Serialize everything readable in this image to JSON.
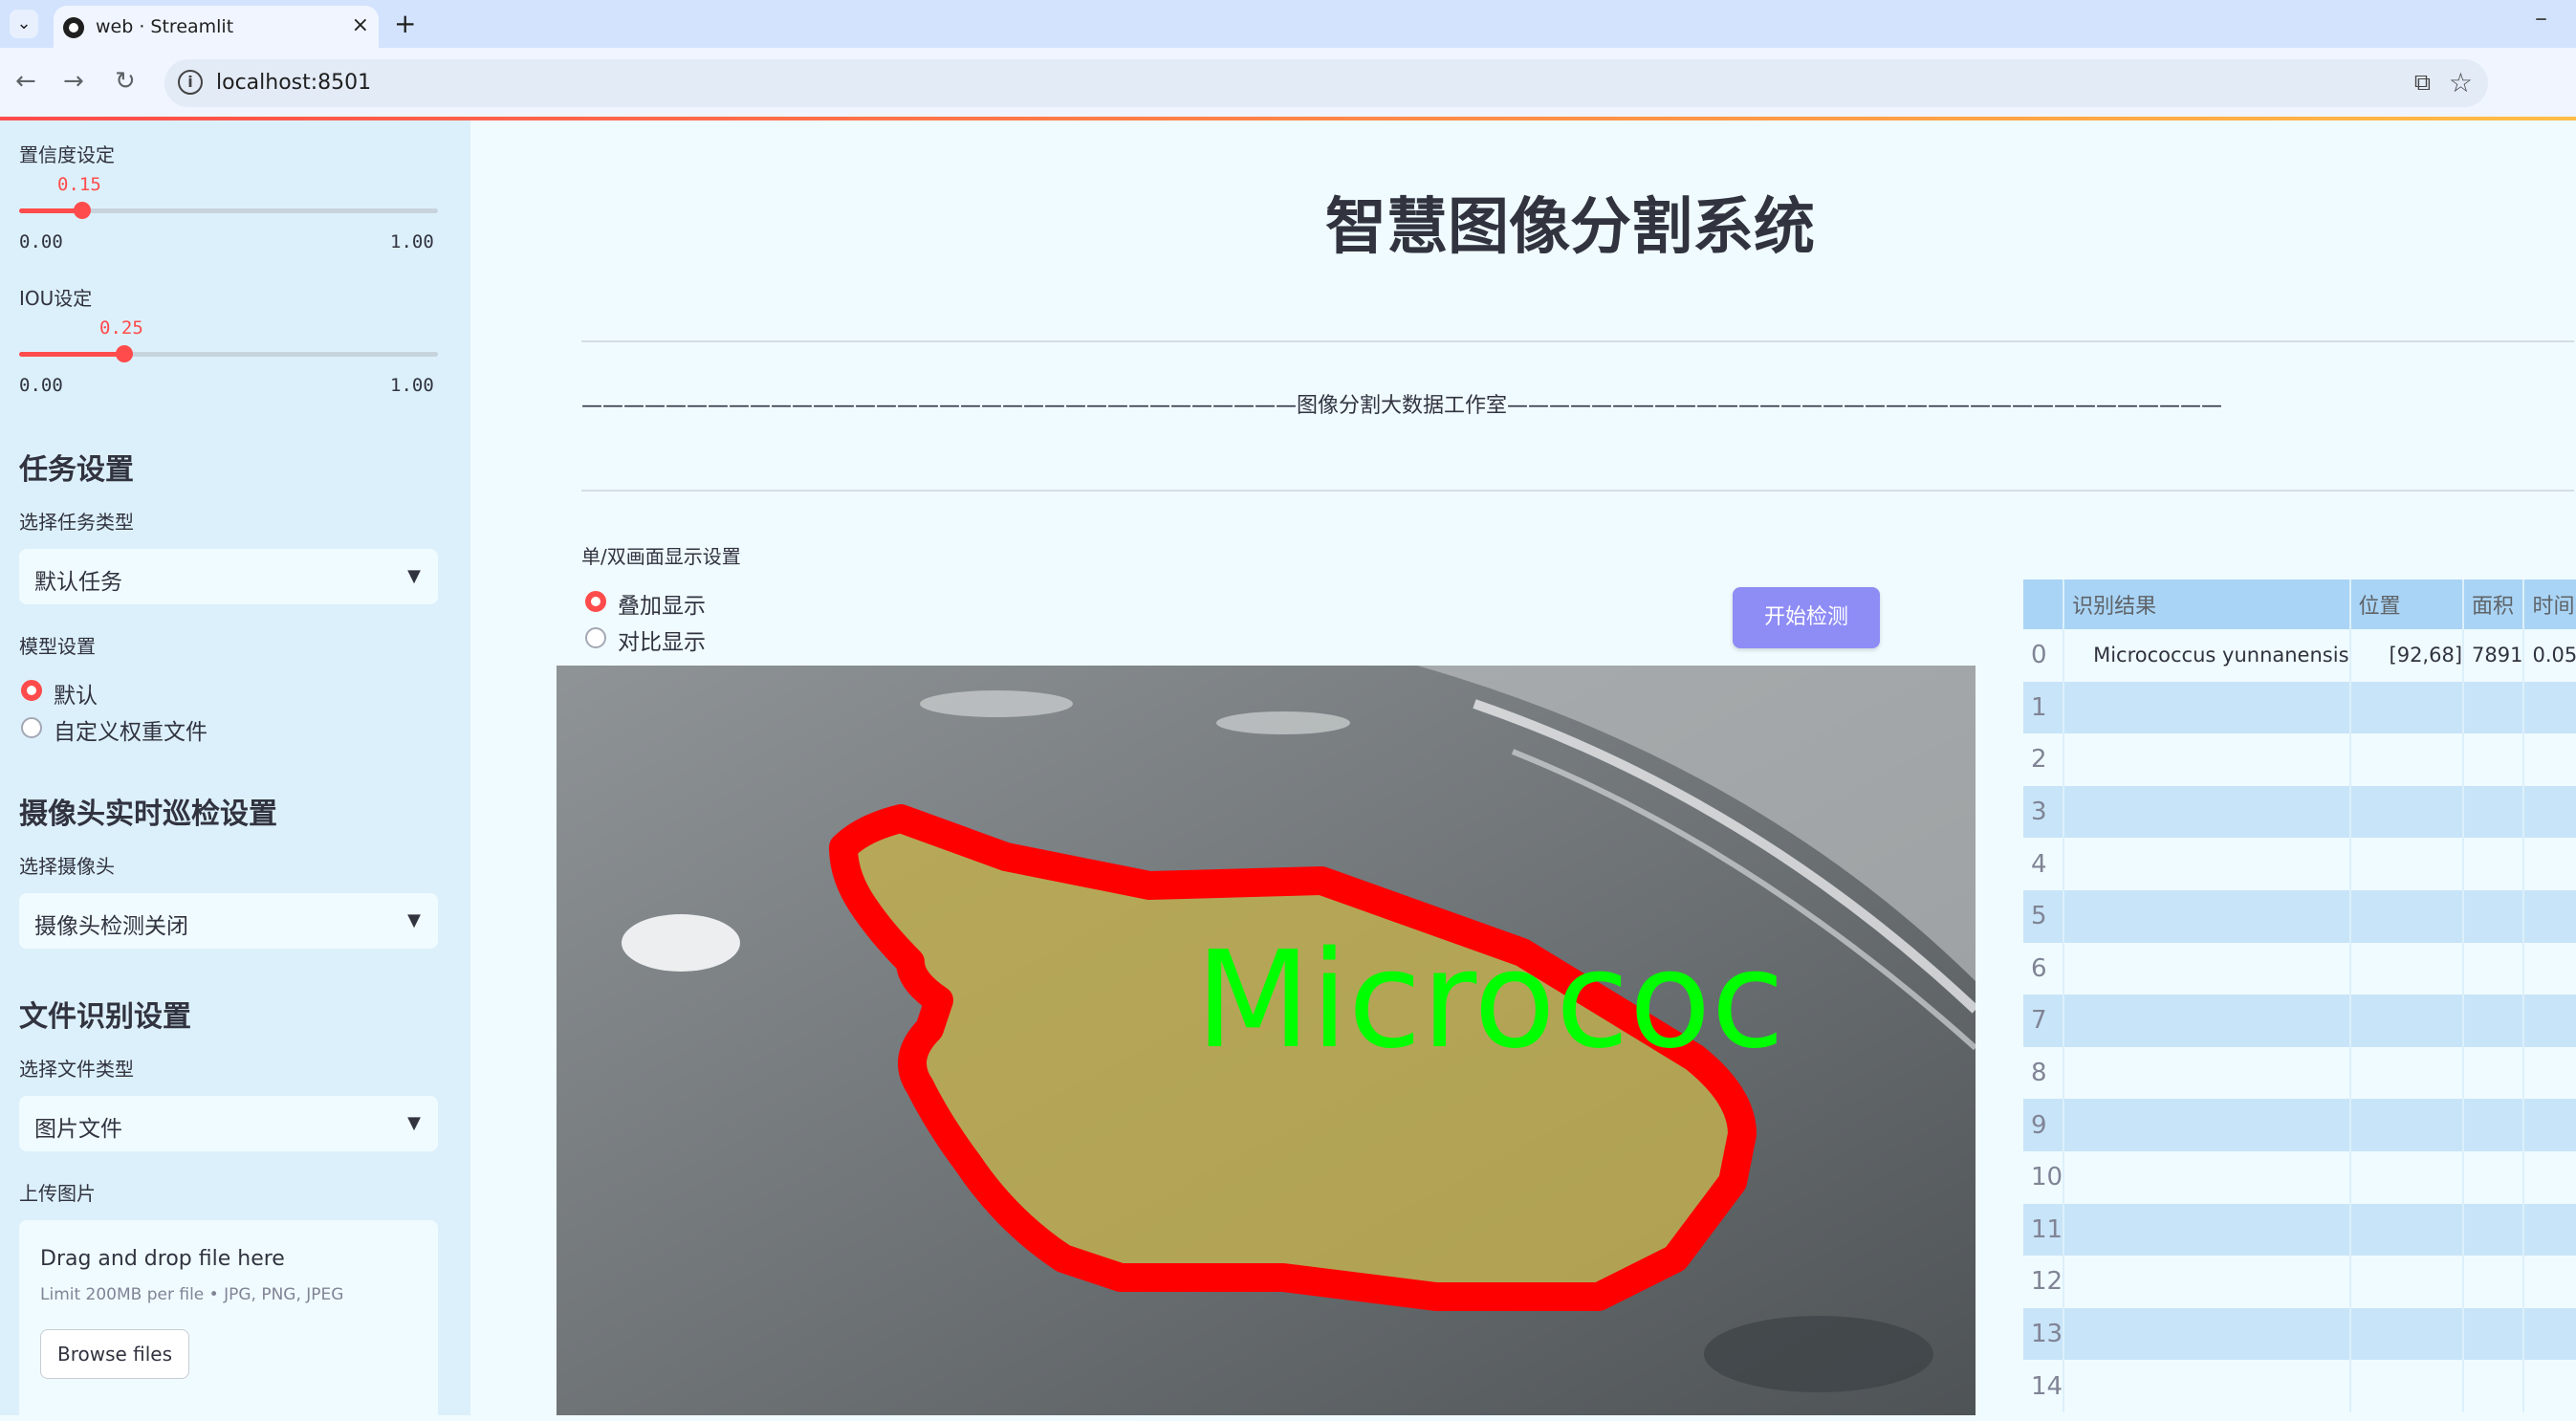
{
  "browser": {
    "tab_title": "web · Streamlit",
    "url": "localhost:8501",
    "icons": [
      "tab-list-icon",
      "favicon-icon",
      "close-icon",
      "new-tab-icon",
      "minimize-icon",
      "back-icon",
      "forward-icon",
      "reload-icon",
      "site-info-icon",
      "translate-icon",
      "star-icon"
    ]
  },
  "sidebar": {
    "confidence": {
      "label": "置信度设定",
      "value": "0.15",
      "min": "0.00",
      "max": "1.00",
      "fraction": 0.15
    },
    "iou": {
      "label": "IOU设定",
      "value": "0.25",
      "min": "0.00",
      "max": "1.00",
      "fraction": 0.25
    },
    "task": {
      "heading": "任务设置",
      "select_label": "选择任务类型",
      "selected": "默认任务"
    },
    "model": {
      "label": "模型设置",
      "options": [
        "默认",
        "自定义权重文件"
      ],
      "selected_index": 0
    },
    "camera": {
      "heading": "摄像头实时巡检设置",
      "select_label": "选择摄像头",
      "selected": "摄像头检测关闭"
    },
    "file": {
      "heading": "文件识别设置",
      "select_label": "选择文件类型",
      "selected": "图片文件",
      "upload_label": "上传图片"
    },
    "uploader": {
      "title": "Drag and drop file here",
      "limit": "Limit 200MB per file • JPG, PNG, JPEG",
      "button": "Browse files"
    }
  },
  "main": {
    "title": "智慧图像分割系统",
    "divider": "——————————————————————————————————图像分割大数据工作室——————————————————————————————————",
    "display": {
      "label": "单/双画面显示设置",
      "options": [
        "叠加显示",
        "对比显示"
      ],
      "selected_index": 0
    },
    "start_button": "开始检测",
    "detection_label": "Micrococ",
    "accent_color": "#ff4b4b",
    "button_color": "#8e8cf5"
  },
  "table": {
    "columns": [
      "",
      "识别结果",
      "位置",
      "面积",
      "时间"
    ],
    "rows": [
      [
        "0",
        "Micrococcus yunnanensis",
        "[92,68]",
        "7891",
        "0.05"
      ],
      [
        "1",
        "",
        "",
        "",
        ""
      ],
      [
        "2",
        "",
        "",
        "",
        ""
      ],
      [
        "3",
        "",
        "",
        "",
        ""
      ],
      [
        "4",
        "",
        "",
        "",
        ""
      ],
      [
        "5",
        "",
        "",
        "",
        ""
      ],
      [
        "6",
        "",
        "",
        "",
        ""
      ],
      [
        "7",
        "",
        "",
        "",
        ""
      ],
      [
        "8",
        "",
        "",
        "",
        ""
      ],
      [
        "9",
        "",
        "",
        "",
        ""
      ],
      [
        "10",
        "",
        "",
        "",
        ""
      ],
      [
        "11",
        "",
        "",
        "",
        ""
      ],
      [
        "12",
        "",
        "",
        "",
        ""
      ],
      [
        "13",
        "",
        "",
        "",
        ""
      ],
      [
        "14",
        "",
        "",
        "",
        ""
      ]
    ]
  }
}
